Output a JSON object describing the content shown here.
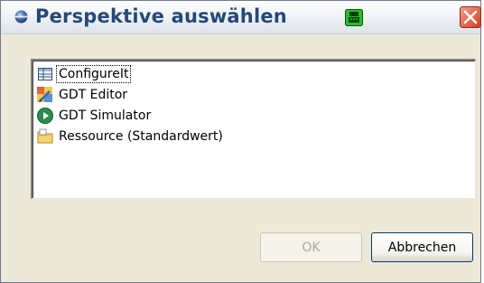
{
  "window": {
    "title": "Perspektive auswählen",
    "title_icon": "blue-circle-icon",
    "badge_icon": "green-keyboard-icon",
    "close_icon": "close-icon"
  },
  "perspectives": [
    {
      "label": "ConfigureIt",
      "icon": "table-grid-icon",
      "focused": true
    },
    {
      "label": "GDT Editor",
      "icon": "gdt-editor-icon",
      "focused": false
    },
    {
      "label": "GDT Simulator",
      "icon": "play-circle-icon",
      "focused": false
    },
    {
      "label": "Ressource (Standardwert)",
      "icon": "folder-icon",
      "focused": false
    }
  ],
  "buttons": {
    "ok_label": "OK",
    "ok_enabled": false,
    "cancel_label": "Abbrechen"
  },
  "colors": {
    "dialog_bg": "#ece9d8",
    "title_text": "#22497c",
    "close_red": "#e24a2b"
  }
}
